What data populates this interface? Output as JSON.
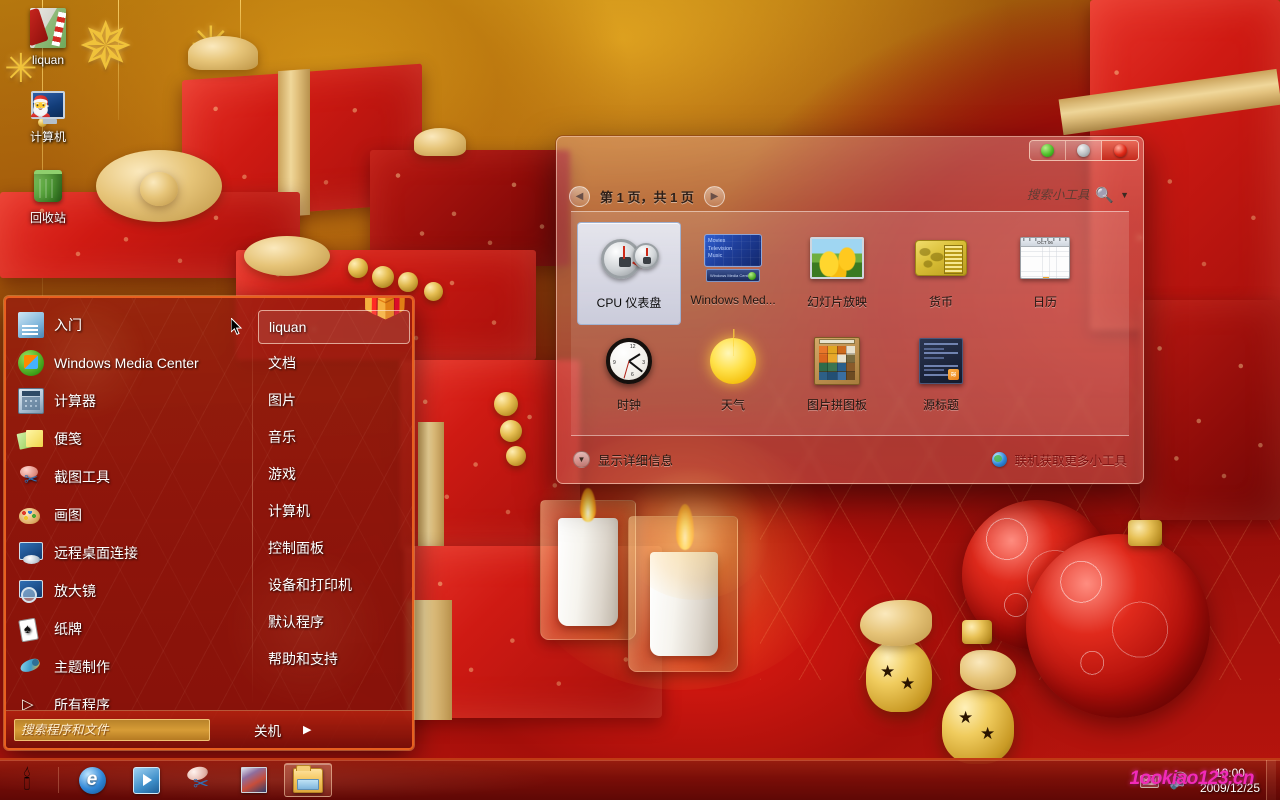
{
  "desktop": {
    "icons": [
      {
        "label": "liquan",
        "icon": "user-folder-gift-icon"
      },
      {
        "label": "计算机",
        "icon": "computer-icon"
      },
      {
        "label": "回收站",
        "icon": "recycle-bin-icon"
      }
    ]
  },
  "start_menu": {
    "left_items": [
      {
        "label": "入门",
        "icon": "getting-started-icon"
      },
      {
        "label": "Windows Media Center",
        "icon": "windows-media-center-icon"
      },
      {
        "label": "计算器",
        "icon": "calculator-icon"
      },
      {
        "label": "便笺",
        "icon": "sticky-notes-icon"
      },
      {
        "label": "截图工具",
        "icon": "snipping-tool-icon"
      },
      {
        "label": "画图",
        "icon": "paint-icon"
      },
      {
        "label": "远程桌面连接",
        "icon": "remote-desktop-icon"
      },
      {
        "label": "放大镜",
        "icon": "magnifier-icon"
      },
      {
        "label": "纸牌",
        "icon": "solitaire-icon"
      },
      {
        "label": "主题制作",
        "icon": "theme-creator-icon"
      },
      {
        "label": "所有程序",
        "icon": "all-programs-icon"
      }
    ],
    "right_items": [
      {
        "label": "liquan",
        "selected": true
      },
      {
        "label": "文档",
        "selected": false
      },
      {
        "label": "图片",
        "selected": false
      },
      {
        "label": "音乐",
        "selected": false
      },
      {
        "label": "游戏",
        "selected": false
      },
      {
        "label": "计算机",
        "selected": false
      },
      {
        "label": "控制面板",
        "selected": false
      },
      {
        "label": "设备和打印机",
        "selected": false
      },
      {
        "label": "默认程序",
        "selected": false
      },
      {
        "label": "帮助和支持",
        "selected": false
      }
    ],
    "search_placeholder": "搜索程序和文件",
    "search_value": "",
    "shutdown_label": "关机",
    "shutdown_arrow": "▶"
  },
  "gadget_window": {
    "page_label": "第 1 页，共 1 页",
    "prev_arrow": "◀",
    "next_arrow": "▶",
    "search_placeholder": "搜索小工具",
    "search_value": "",
    "search_icon": "magnifier-icon",
    "dropdown_icon": "chevron-down-icon",
    "controls": {
      "minimize": "minimize-ornament-button",
      "maximize": "maximize-ornament-button",
      "close": "close-ornament-button"
    },
    "gadgets": [
      {
        "name": "CPU 仪表盘",
        "thumb": "cpu-meter-thumb",
        "selected": true
      },
      {
        "name": "Windows Med...",
        "thumb": "windows-media-center-thumb",
        "selected": false
      },
      {
        "name": "幻灯片放映",
        "thumb": "slideshow-thumb",
        "selected": false
      },
      {
        "name": "货币",
        "thumb": "currency-thumb",
        "selected": false
      },
      {
        "name": "日历",
        "thumb": "calendar-thumb",
        "selected": false
      },
      {
        "name": "时钟",
        "thumb": "clock-thumb",
        "selected": false
      },
      {
        "name": "天气",
        "thumb": "weather-sun-thumb",
        "selected": false
      },
      {
        "name": "图片拼图板",
        "thumb": "picture-puzzle-thumb",
        "selected": false
      },
      {
        "name": "源标题",
        "thumb": "feed-headlines-thumb",
        "selected": false
      }
    ],
    "calendar_thumb": {
      "header": "OCT 06",
      "day_letters": "S M T W T F S"
    },
    "wmc_thumb_lines": "Movies\nTelevision\nMusic",
    "wmc_thumb_bar": "Windows Media Center",
    "footer": {
      "details_label": "显示详细信息",
      "details_icon": "chevron-down-icon",
      "online_label": "联机获取更多小工具",
      "online_icon": "globe-icon"
    }
  },
  "taskbar": {
    "start_button": "start-orb-candle",
    "buttons": [
      {
        "name": "internet-explorer",
        "icon": "internet-explorer-icon",
        "active": false
      },
      {
        "name": "windows-media-player",
        "icon": "media-player-icon",
        "active": false
      },
      {
        "name": "snipping-tool",
        "icon": "snipping-tool-icon",
        "active": false
      },
      {
        "name": "art-app",
        "icon": "art-app-icon",
        "active": false
      },
      {
        "name": "windows-explorer",
        "icon": "folder-icon",
        "active": true
      }
    ],
    "tray": {
      "keyboard_icon": "keyboard-icon",
      "volume_icon": "volume-icon",
      "time": "10:00",
      "date": "2009/12/25"
    },
    "watermark": "1ookiao123.cn"
  },
  "colors": {
    "accent_red": "#c03a14",
    "start_border": "#e8601f",
    "gold": "#e6c478",
    "watermark_pink": "#f22ab8",
    "selection_blue": "#ceddf0"
  }
}
